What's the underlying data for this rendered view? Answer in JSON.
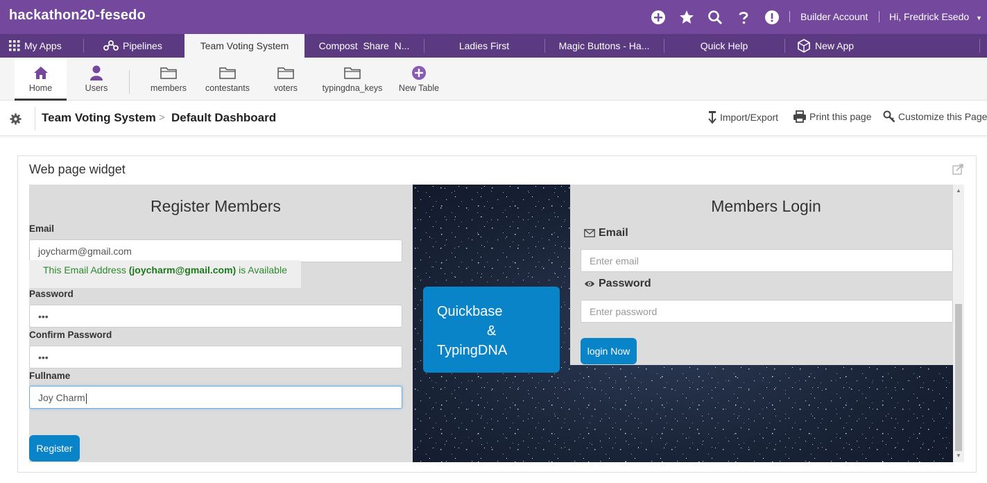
{
  "app": {
    "name": "hackathon20-fesedo",
    "builder_label": "Builder Account",
    "user_greeting": "Hi, Fredrick Esedo",
    "user_caret": "▼"
  },
  "top_icons": [
    "plus-circle-icon",
    "star-icon",
    "search-icon",
    "help-icon",
    "alert-icon"
  ],
  "tabs": [
    {
      "label": "My Apps"
    },
    {
      "label": "Pipelines"
    },
    {
      "label": "Team Voting System"
    },
    {
      "label": "Compost  Share  N..."
    },
    {
      "label": "Ladies First"
    },
    {
      "label": "Magic Buttons - Ha..."
    },
    {
      "label": "Quick Help"
    },
    {
      "label": "New App"
    }
  ],
  "tables": [
    {
      "label": "Home"
    },
    {
      "label": "Users"
    },
    {
      "label": "members"
    },
    {
      "label": "contestants"
    },
    {
      "label": "voters"
    },
    {
      "label": "typingdna_keys"
    },
    {
      "label": "New Table"
    }
  ],
  "breadcrumb": {
    "app": "Team Voting System",
    "separator": ">",
    "page": "Default Dashboard"
  },
  "actions": {
    "import_export": "Import/Export",
    "print": "Print this page",
    "customize": "Customize this Page"
  },
  "widget": {
    "title": "Web page widget"
  },
  "register": {
    "heading": "Register Members",
    "email_label": "Email",
    "email_value": "joycharm@gmail.com",
    "avail_prefix": "This Email Address ",
    "avail_email": "(joycharm@gmail.com)",
    "avail_suffix": " is Available",
    "password_label": "Password",
    "password_value": "•••",
    "confirm_label": "Confirm Password",
    "confirm_value": "•••",
    "fullname_label": "Fullname",
    "fullname_value": "Joy Charm",
    "register_button": "Register"
  },
  "banner": {
    "line1": "Quickbase",
    "line2": "&",
    "line3": "TypingDNA"
  },
  "login": {
    "heading": "Members Login",
    "email_label": "Email",
    "email_placeholder": "Enter email",
    "password_label": "Password",
    "password_placeholder": "Enter password",
    "login_button": "login Now"
  },
  "colors": {
    "topbar": "#74489d",
    "tabsbar": "#5c3a82",
    "button_blue": "#0a84c9",
    "available_green": "#2b8a2b"
  }
}
